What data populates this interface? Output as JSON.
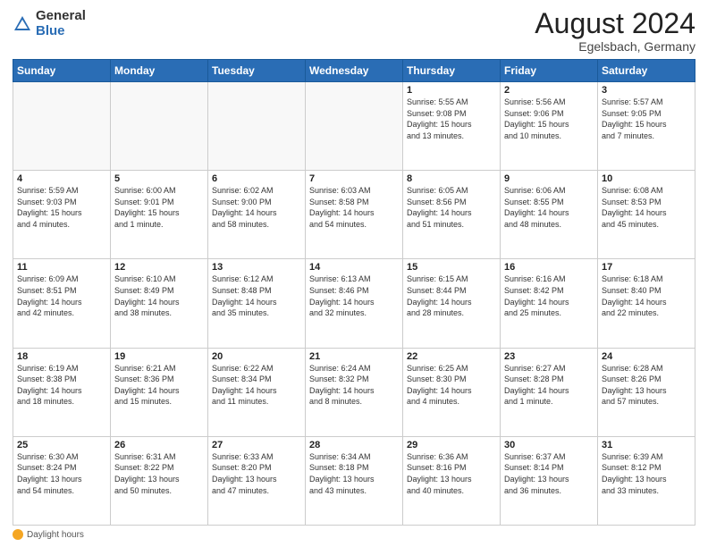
{
  "header": {
    "logo_general": "General",
    "logo_blue": "Blue",
    "month_title": "August 2024",
    "location": "Egelsbach, Germany"
  },
  "footer": {
    "daylight_label": "Daylight hours"
  },
  "days_of_week": [
    "Sunday",
    "Monday",
    "Tuesday",
    "Wednesday",
    "Thursday",
    "Friday",
    "Saturday"
  ],
  "weeks": [
    [
      {
        "num": "",
        "info": ""
      },
      {
        "num": "",
        "info": ""
      },
      {
        "num": "",
        "info": ""
      },
      {
        "num": "",
        "info": ""
      },
      {
        "num": "1",
        "info": "Sunrise: 5:55 AM\nSunset: 9:08 PM\nDaylight: 15 hours\nand 13 minutes."
      },
      {
        "num": "2",
        "info": "Sunrise: 5:56 AM\nSunset: 9:06 PM\nDaylight: 15 hours\nand 10 minutes."
      },
      {
        "num": "3",
        "info": "Sunrise: 5:57 AM\nSunset: 9:05 PM\nDaylight: 15 hours\nand 7 minutes."
      }
    ],
    [
      {
        "num": "4",
        "info": "Sunrise: 5:59 AM\nSunset: 9:03 PM\nDaylight: 15 hours\nand 4 minutes."
      },
      {
        "num": "5",
        "info": "Sunrise: 6:00 AM\nSunset: 9:01 PM\nDaylight: 15 hours\nand 1 minute."
      },
      {
        "num": "6",
        "info": "Sunrise: 6:02 AM\nSunset: 9:00 PM\nDaylight: 14 hours\nand 58 minutes."
      },
      {
        "num": "7",
        "info": "Sunrise: 6:03 AM\nSunset: 8:58 PM\nDaylight: 14 hours\nand 54 minutes."
      },
      {
        "num": "8",
        "info": "Sunrise: 6:05 AM\nSunset: 8:56 PM\nDaylight: 14 hours\nand 51 minutes."
      },
      {
        "num": "9",
        "info": "Sunrise: 6:06 AM\nSunset: 8:55 PM\nDaylight: 14 hours\nand 48 minutes."
      },
      {
        "num": "10",
        "info": "Sunrise: 6:08 AM\nSunset: 8:53 PM\nDaylight: 14 hours\nand 45 minutes."
      }
    ],
    [
      {
        "num": "11",
        "info": "Sunrise: 6:09 AM\nSunset: 8:51 PM\nDaylight: 14 hours\nand 42 minutes."
      },
      {
        "num": "12",
        "info": "Sunrise: 6:10 AM\nSunset: 8:49 PM\nDaylight: 14 hours\nand 38 minutes."
      },
      {
        "num": "13",
        "info": "Sunrise: 6:12 AM\nSunset: 8:48 PM\nDaylight: 14 hours\nand 35 minutes."
      },
      {
        "num": "14",
        "info": "Sunrise: 6:13 AM\nSunset: 8:46 PM\nDaylight: 14 hours\nand 32 minutes."
      },
      {
        "num": "15",
        "info": "Sunrise: 6:15 AM\nSunset: 8:44 PM\nDaylight: 14 hours\nand 28 minutes."
      },
      {
        "num": "16",
        "info": "Sunrise: 6:16 AM\nSunset: 8:42 PM\nDaylight: 14 hours\nand 25 minutes."
      },
      {
        "num": "17",
        "info": "Sunrise: 6:18 AM\nSunset: 8:40 PM\nDaylight: 14 hours\nand 22 minutes."
      }
    ],
    [
      {
        "num": "18",
        "info": "Sunrise: 6:19 AM\nSunset: 8:38 PM\nDaylight: 14 hours\nand 18 minutes."
      },
      {
        "num": "19",
        "info": "Sunrise: 6:21 AM\nSunset: 8:36 PM\nDaylight: 14 hours\nand 15 minutes."
      },
      {
        "num": "20",
        "info": "Sunrise: 6:22 AM\nSunset: 8:34 PM\nDaylight: 14 hours\nand 11 minutes."
      },
      {
        "num": "21",
        "info": "Sunrise: 6:24 AM\nSunset: 8:32 PM\nDaylight: 14 hours\nand 8 minutes."
      },
      {
        "num": "22",
        "info": "Sunrise: 6:25 AM\nSunset: 8:30 PM\nDaylight: 14 hours\nand 4 minutes."
      },
      {
        "num": "23",
        "info": "Sunrise: 6:27 AM\nSunset: 8:28 PM\nDaylight: 14 hours\nand 1 minute."
      },
      {
        "num": "24",
        "info": "Sunrise: 6:28 AM\nSunset: 8:26 PM\nDaylight: 13 hours\nand 57 minutes."
      }
    ],
    [
      {
        "num": "25",
        "info": "Sunrise: 6:30 AM\nSunset: 8:24 PM\nDaylight: 13 hours\nand 54 minutes."
      },
      {
        "num": "26",
        "info": "Sunrise: 6:31 AM\nSunset: 8:22 PM\nDaylight: 13 hours\nand 50 minutes."
      },
      {
        "num": "27",
        "info": "Sunrise: 6:33 AM\nSunset: 8:20 PM\nDaylight: 13 hours\nand 47 minutes."
      },
      {
        "num": "28",
        "info": "Sunrise: 6:34 AM\nSunset: 8:18 PM\nDaylight: 13 hours\nand 43 minutes."
      },
      {
        "num": "29",
        "info": "Sunrise: 6:36 AM\nSunset: 8:16 PM\nDaylight: 13 hours\nand 40 minutes."
      },
      {
        "num": "30",
        "info": "Sunrise: 6:37 AM\nSunset: 8:14 PM\nDaylight: 13 hours\nand 36 minutes."
      },
      {
        "num": "31",
        "info": "Sunrise: 6:39 AM\nSunset: 8:12 PM\nDaylight: 13 hours\nand 33 minutes."
      }
    ]
  ]
}
